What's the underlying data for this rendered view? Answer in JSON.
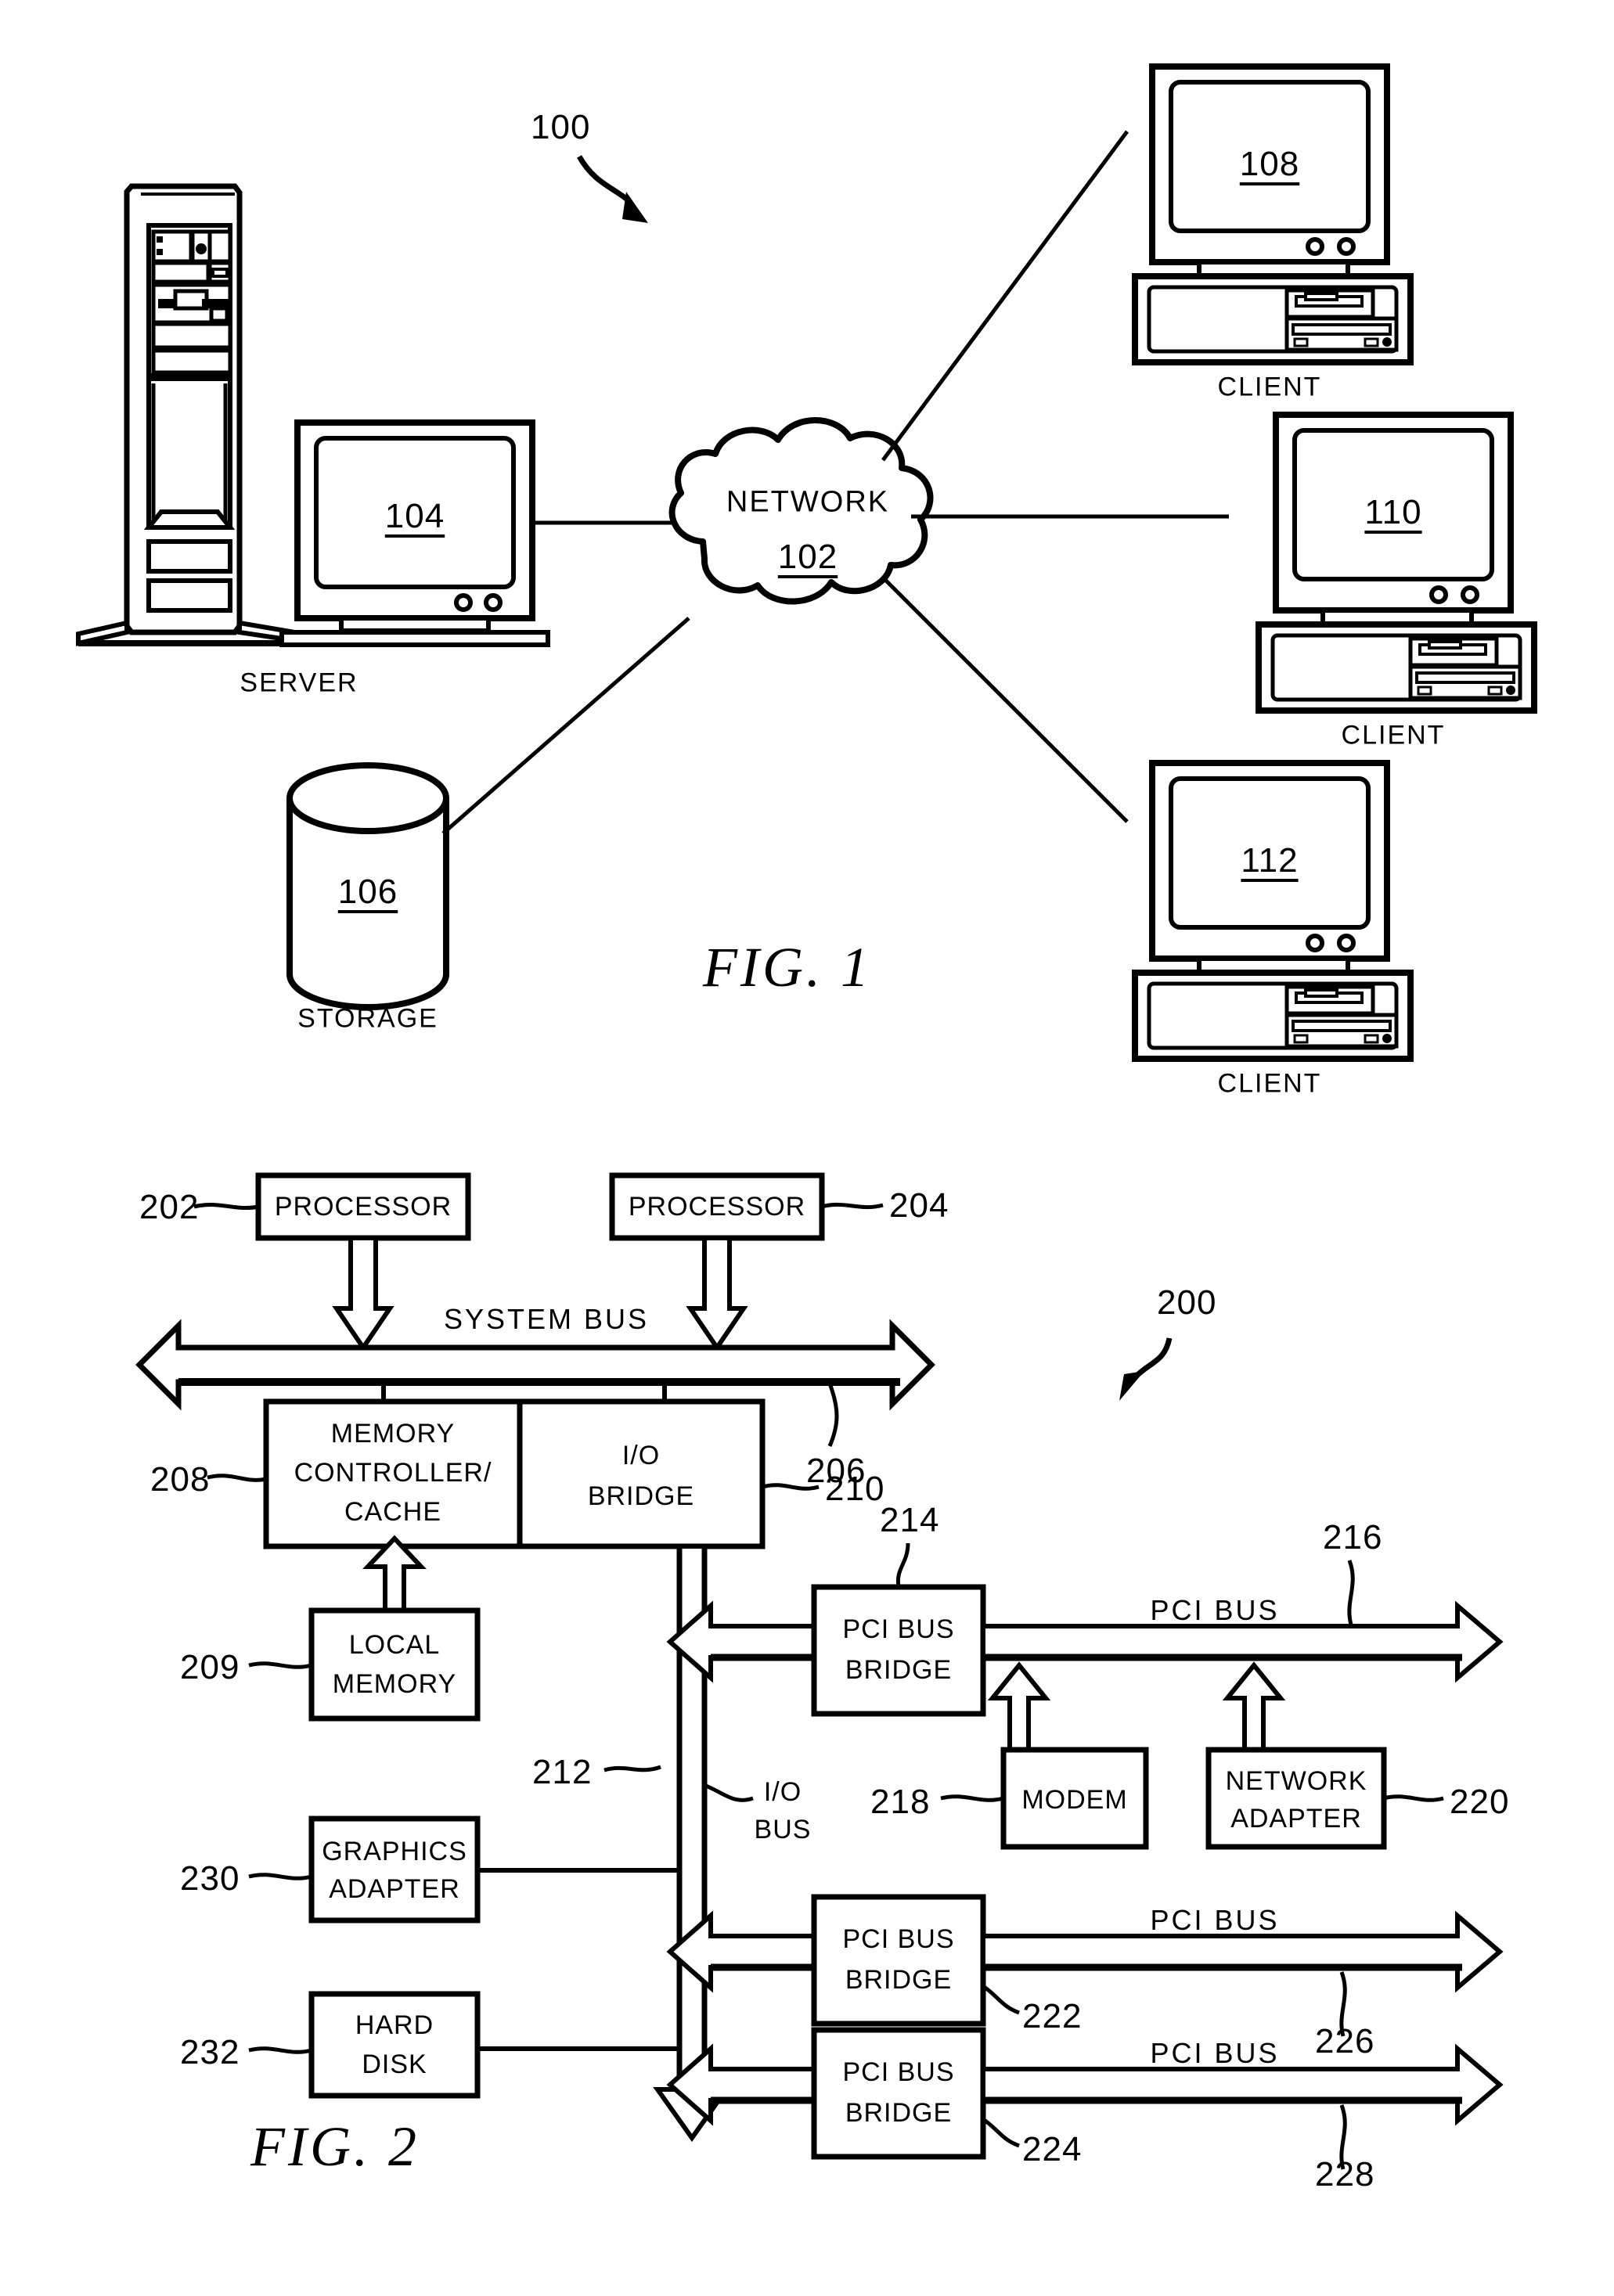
{
  "figures": [
    {
      "id": "fig1",
      "caption": "FIG.  1",
      "ref_label": "100",
      "nodes": {
        "server_tower": {
          "label": "SERVER"
        },
        "server_monitor": {
          "ref": "104"
        },
        "storage": {
          "ref": "106",
          "label": "STORAGE"
        },
        "network_cloud": {
          "name": "NETWORK",
          "ref": "102"
        },
        "client_top": {
          "ref": "108",
          "label": "CLIENT"
        },
        "client_mid": {
          "ref": "110",
          "label": "CLIENT"
        },
        "client_bot": {
          "ref": "112",
          "label": "CLIENT"
        }
      }
    },
    {
      "id": "fig2",
      "caption": "FIG.  2",
      "ref_label": "200",
      "boxes": {
        "processor_left": {
          "label": "PROCESSOR",
          "ref": "202"
        },
        "processor_right": {
          "label": "PROCESSOR",
          "ref": "204"
        },
        "memory_controller": {
          "label": "MEMORY\nCONTROLLER/\nCACHE",
          "ref": "208"
        },
        "io_bridge": {
          "label": "I/O\nBRIDGE",
          "ref": "210"
        },
        "local_memory": {
          "label": "LOCAL\nMEMORY",
          "ref": "209"
        },
        "graphics_adapter": {
          "label": "GRAPHICS\nADAPTER",
          "ref": "230"
        },
        "hard_disk": {
          "label": "HARD\nDISK",
          "ref": "232"
        },
        "pci_bridge_1": {
          "label": "PCI BUS\nBRIDGE",
          "ref": "214"
        },
        "pci_bridge_2": {
          "label": "PCI BUS\nBRIDGE",
          "ref": "222"
        },
        "pci_bridge_3": {
          "label": "PCI BUS\nBRIDGE",
          "ref": "224"
        },
        "modem": {
          "label": "MODEM",
          "ref": "218"
        },
        "network_adapter": {
          "label": "NETWORK\nADAPTER",
          "ref": "220"
        }
      },
      "buses": {
        "system_bus": {
          "label": "SYSTEM  BUS",
          "ref": "206"
        },
        "io_bus": {
          "label": "I/O\nBUS",
          "ref": "212"
        },
        "pci_bus_1": {
          "label": "PCI  BUS",
          "ref": "216"
        },
        "pci_bus_2": {
          "label": "PCI  BUS",
          "ref": "226"
        },
        "pci_bus_3": {
          "label": "PCI  BUS",
          "ref": "228"
        }
      }
    }
  ],
  "text": {
    "fig1_caption": "FIG.  1",
    "fig2_caption": "FIG.  2",
    "ref_100": "100",
    "ref_102": "102",
    "ref_104": "104",
    "ref_106": "106",
    "ref_108": "108",
    "ref_110": "110",
    "ref_112": "112",
    "ref_200": "200",
    "ref_202": "202",
    "ref_204": "204",
    "ref_206": "206",
    "ref_208": "208",
    "ref_209": "209",
    "ref_210": "210",
    "ref_212": "212",
    "ref_214": "214",
    "ref_216": "216",
    "ref_218": "218",
    "ref_220": "220",
    "ref_222": "222",
    "ref_224": "224",
    "ref_226": "226",
    "ref_228": "228",
    "ref_230": "230",
    "ref_232": "232",
    "network": "NETWORK",
    "server": "SERVER",
    "storage": "STORAGE",
    "client1": "CLIENT",
    "client2": "CLIENT",
    "client3": "CLIENT",
    "processor1": "PROCESSOR",
    "processor2": "PROCESSOR",
    "system_bus": "SYSTEM  BUS",
    "memory_controller_l1": "MEMORY",
    "memory_controller_l2": "CONTROLLER/",
    "memory_controller_l3": "CACHE",
    "io_bridge_l1": "I/O",
    "io_bridge_l2": "BRIDGE",
    "local_memory_l1": "LOCAL",
    "local_memory_l2": "MEMORY",
    "graphics_l1": "GRAPHICS",
    "graphics_l2": "ADAPTER",
    "harddisk_l1": "HARD",
    "harddisk_l2": "DISK",
    "pci_bridge_l1": "PCI BUS",
    "pci_bridge_l2": "BRIDGE",
    "modem": "MODEM",
    "netadapter_l1": "NETWORK",
    "netadapter_l2": "ADAPTER",
    "io_bus_l1": "I/O",
    "io_bus_l2": "BUS",
    "pci_bus": "PCI  BUS"
  }
}
